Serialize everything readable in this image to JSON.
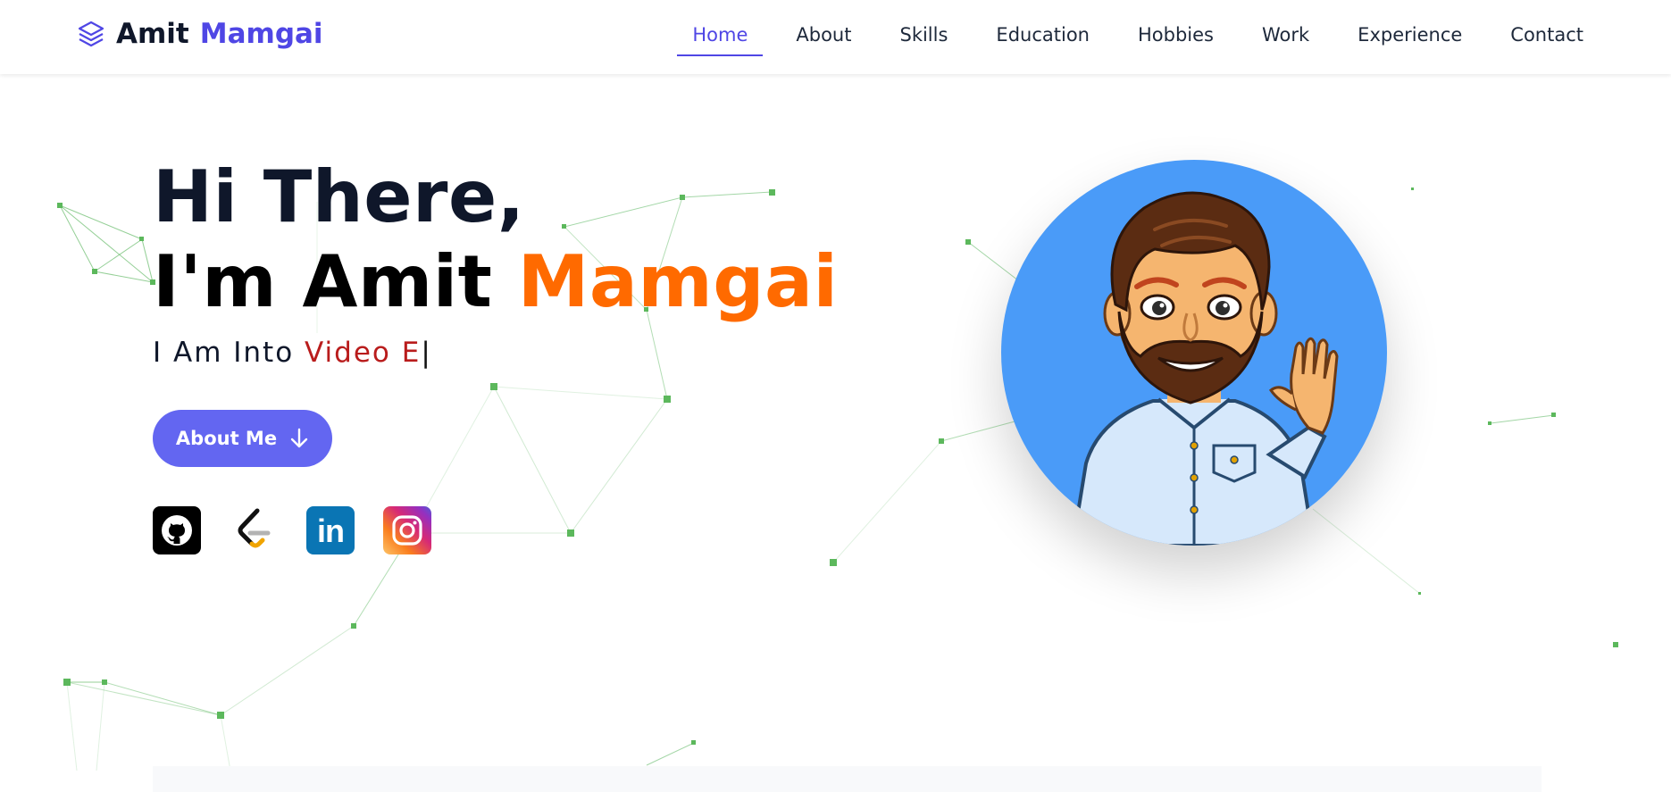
{
  "brand": {
    "first": "Amit",
    "last": "Mamgai",
    "icon": "layers-icon",
    "accent": "#4f46e5"
  },
  "nav": {
    "items": [
      {
        "label": "Home",
        "active": true
      },
      {
        "label": "About"
      },
      {
        "label": "Skills"
      },
      {
        "label": "Education"
      },
      {
        "label": "Hobbies"
      },
      {
        "label": "Work"
      },
      {
        "label": "Experience"
      },
      {
        "label": "Contact"
      }
    ]
  },
  "hero": {
    "greeting": "Hi There,",
    "intro": "I'm Amit",
    "name": "Mamgai",
    "typed_prefix": "I Am Into",
    "typed_text": "Video E",
    "caret": "|",
    "button_label": "About Me",
    "button_icon": "arrow-down-icon",
    "name_color": "#ff6a00",
    "typed_color": "#b91c1c",
    "button_color": "#6366f1"
  },
  "socials": [
    {
      "name": "github",
      "icon": "github-icon"
    },
    {
      "name": "leetcode",
      "icon": "leetcode-icon"
    },
    {
      "name": "linkedin",
      "icon": "linkedin-icon",
      "text": "in"
    },
    {
      "name": "instagram",
      "icon": "instagram-icon"
    }
  ],
  "avatar": {
    "icon": "waving-man-avatar",
    "bg_color": "#4a9bf8"
  },
  "particles": {
    "color": "#5cb85c"
  }
}
